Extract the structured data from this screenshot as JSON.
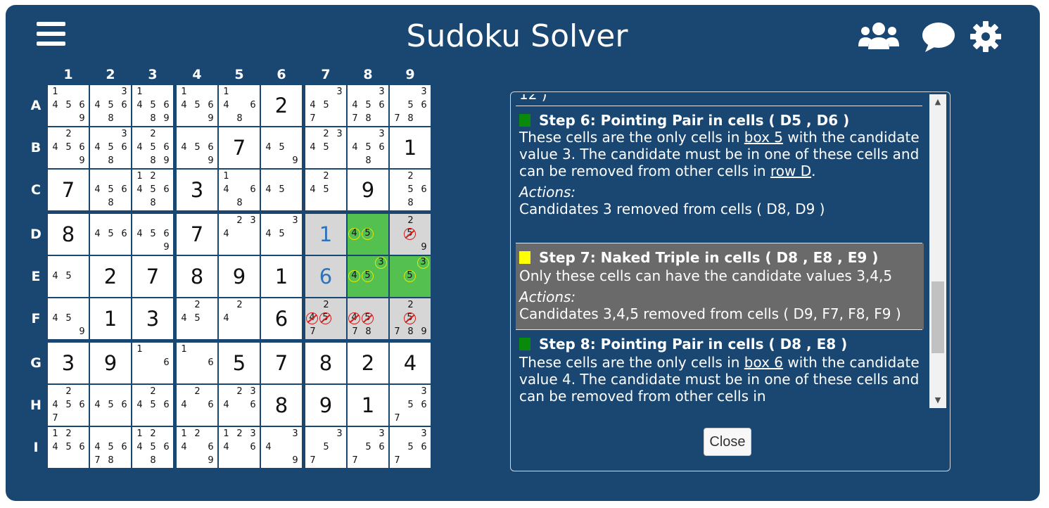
{
  "header": {
    "title": "Sudoku Solver",
    "icons": [
      "menu-icon",
      "users-icon",
      "chat-icon",
      "settings-gear-icon"
    ]
  },
  "grid": {
    "col_labels": [
      "1",
      "2",
      "3",
      "4",
      "5",
      "6",
      "7",
      "8",
      "9"
    ],
    "row_labels": [
      "A",
      "B",
      "C",
      "D",
      "E",
      "F",
      "G",
      "H",
      "I"
    ],
    "cells": [
      [
        {
          "c": [
            1,
            4,
            5,
            6,
            9
          ]
        },
        {
          "c": [
            3,
            4,
            5,
            6,
            8
          ]
        },
        {
          "c": [
            1,
            4,
            5,
            6,
            8,
            9
          ]
        },
        {
          "c": [
            1,
            4,
            5,
            6,
            9
          ]
        },
        {
          "c": [
            1,
            4,
            6,
            8
          ]
        },
        {
          "v": "2"
        },
        {
          "c": [
            3,
            4,
            5,
            7
          ]
        },
        {
          "c": [
            3,
            4,
            5,
            6,
            7,
            8
          ]
        },
        {
          "c": [
            3,
            5,
            6,
            7,
            8
          ]
        }
      ],
      [
        {
          "c": [
            2,
            4,
            5,
            6,
            9
          ]
        },
        {
          "c": [
            3,
            4,
            5,
            6,
            8
          ]
        },
        {
          "c": [
            2,
            4,
            5,
            6,
            8,
            9
          ]
        },
        {
          "c": [
            4,
            5,
            6,
            9
          ]
        },
        {
          "v": "7"
        },
        {
          "c": [
            4,
            5,
            9
          ]
        },
        {
          "c": [
            2,
            3,
            4,
            5
          ]
        },
        {
          "c": [
            3,
            4,
            5,
            6,
            8
          ]
        },
        {
          "v": "1"
        }
      ],
      [
        {
          "v": "7"
        },
        {
          "c": [
            4,
            5,
            6,
            8
          ]
        },
        {
          "c": [
            1,
            2,
            4,
            5,
            6,
            8
          ]
        },
        {
          "v": "3"
        },
        {
          "c": [
            1,
            4,
            6,
            8
          ]
        },
        {
          "c": [
            4,
            5
          ]
        },
        {
          "c": [
            2,
            4,
            5
          ]
        },
        {
          "v": "9"
        },
        {
          "c": [
            2,
            5,
            6,
            8
          ]
        }
      ],
      [
        {
          "v": "8"
        },
        {
          "c": [
            4,
            5,
            6
          ]
        },
        {
          "c": [
            4,
            5,
            6,
            9
          ]
        },
        {
          "v": "7"
        },
        {
          "c": [
            2,
            3,
            4
          ]
        },
        {
          "c": [
            3,
            4,
            5
          ]
        },
        {
          "v": "1",
          "blue": true,
          "bg": "gray"
        },
        {
          "c": [
            4,
            5
          ],
          "bg": "green",
          "y": [
            4,
            5
          ]
        },
        {
          "c": [
            2,
            5,
            9
          ],
          "bg": "gray",
          "r": [
            5
          ]
        }
      ],
      [
        {
          "c": [
            4,
            5
          ]
        },
        {
          "v": "2"
        },
        {
          "v": "7"
        },
        {
          "v": "8"
        },
        {
          "v": "9"
        },
        {
          "v": "1"
        },
        {
          "v": "6",
          "blue": true,
          "bg": "gray"
        },
        {
          "c": [
            3,
            4,
            5
          ],
          "bg": "green",
          "y": [
            3,
            4,
            5
          ]
        },
        {
          "c": [
            3,
            5
          ],
          "bg": "green",
          "y": [
            3,
            5
          ]
        }
      ],
      [
        {
          "c": [
            4,
            5,
            9
          ]
        },
        {
          "v": "1"
        },
        {
          "v": "3"
        },
        {
          "c": [
            2,
            4,
            5
          ]
        },
        {
          "c": [
            2,
            4
          ]
        },
        {
          "v": "6"
        },
        {
          "c": [
            2,
            4,
            5,
            7
          ],
          "bg": "gray",
          "r": [
            4,
            5
          ]
        },
        {
          "c": [
            4,
            5,
            7,
            8
          ],
          "bg": "gray",
          "r": [
            4,
            5
          ]
        },
        {
          "c": [
            2,
            5,
            7,
            8,
            9
          ],
          "bg": "gray",
          "r": [
            5
          ]
        }
      ],
      [
        {
          "v": "3"
        },
        {
          "v": "9"
        },
        {
          "c": [
            1,
            6
          ]
        },
        {
          "c": [
            1,
            6
          ]
        },
        {
          "v": "5"
        },
        {
          "v": "7"
        },
        {
          "v": "8"
        },
        {
          "v": "2"
        },
        {
          "v": "4"
        }
      ],
      [
        {
          "c": [
            2,
            4,
            5,
            6,
            7
          ]
        },
        {
          "c": [
            4,
            5,
            6
          ]
        },
        {
          "c": [
            2,
            4,
            5,
            6
          ]
        },
        {
          "c": [
            2,
            4,
            6
          ]
        },
        {
          "c": [
            2,
            3,
            4,
            6
          ]
        },
        {
          "v": "8"
        },
        {
          "v": "9"
        },
        {
          "v": "1"
        },
        {
          "c": [
            3,
            5,
            6,
            7
          ]
        }
      ],
      [
        {
          "c": [
            1,
            2,
            4,
            5,
            6
          ]
        },
        {
          "c": [
            4,
            5,
            6,
            7,
            8
          ]
        },
        {
          "c": [
            1,
            2,
            4,
            5,
            6,
            8
          ]
        },
        {
          "c": [
            1,
            2,
            4,
            6,
            9
          ]
        },
        {
          "c": [
            1,
            2,
            3,
            4,
            6
          ]
        },
        {
          "c": [
            3,
            4,
            9
          ]
        },
        {
          "c": [
            3,
            5,
            7
          ]
        },
        {
          "c": [
            3,
            5,
            6,
            7
          ]
        },
        {
          "c": [
            3,
            5,
            6,
            7
          ]
        }
      ]
    ]
  },
  "steps": {
    "prev_cut": "12 )",
    "step6": {
      "title": "Step 6: Pointing Pair in cells ( D5 , D6 )",
      "marker_color": "#0a8a0a",
      "text_a": "These cells are the only cells in ",
      "link_a": "box 5",
      "text_b": " with the candidate value 3. The candidate must be in one of these cells and can be removed from other cells in ",
      "link_b": "row D",
      "text_c": ".",
      "actions_label": "Actions:",
      "actions_text": "Candidates 3 removed from cells ( D8, D9 )"
    },
    "step7": {
      "title": "Step 7: Naked Triple in cells ( D8 , E8 , E9 )",
      "marker_color": "#ffff00",
      "text": "Only these cells can have the candidate values 3,4,5",
      "actions_label": "Actions:",
      "actions_text": "Candidates 3,4,5 removed from cells ( D9, F7, F8, F9 )"
    },
    "step8": {
      "title": "Step 8: Pointing Pair in cells ( D8 , E8 )",
      "marker_color": "#0a8a0a",
      "text_a": "These cells are the only cells in ",
      "link_a": "box 6",
      "text_b": " with the candidate value 4. The candidate must be in one of these cells and can be removed from other cells in"
    }
  },
  "close_label": "Close"
}
